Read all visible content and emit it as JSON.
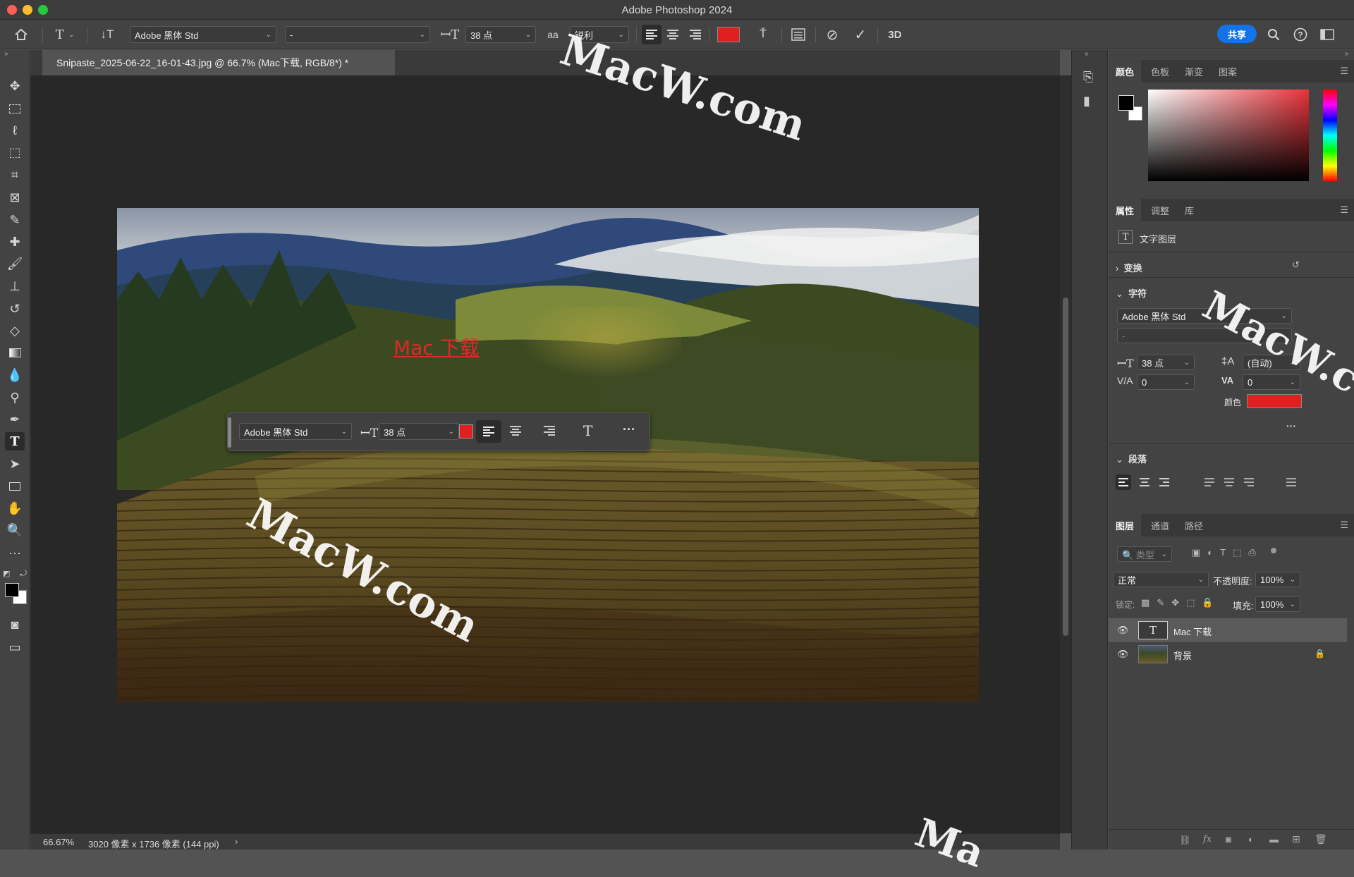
{
  "app": {
    "title": "Adobe Photoshop 2024",
    "share_label": "共享"
  },
  "options_bar": {
    "font_family": "Adobe 黑体 Std",
    "font_style": "-",
    "font_size": "38 点",
    "antialias_label": "aa",
    "antialias_value": "锐利",
    "text_color": "#e02020",
    "three_d_label": "3D"
  },
  "document": {
    "tab_title": "Snipaste_2025-06-22_16-01-43.jpg @ 66.7% (Mac下载, RGB/8*) *",
    "text_layer_content": "Mac 下载",
    "status_zoom": "66.67%",
    "status_info": "3020 像素 x 1736 像素 (144 ppi)"
  },
  "context_bar": {
    "font_family": "Adobe 黑体 Std",
    "font_size": "38 点",
    "color": "#e02020",
    "more_label": "···"
  },
  "color_panel": {
    "tabs": [
      "颜色",
      "色板",
      "渐变",
      "图案"
    ],
    "foreground": "#000000",
    "background": "#ffffff",
    "hue_color": "#e8333a"
  },
  "properties_panel": {
    "tabs": [
      "属性",
      "调整",
      "库"
    ],
    "layer_kind": "文字图层",
    "transform_label": "变换",
    "character_label": "字符",
    "font_family": "Adobe 黑体 Std",
    "font_style": "-",
    "size_value": "38 点",
    "leading_value": "(自动)",
    "kerning_value": "0",
    "tracking_value": "0",
    "color_label": "颜色",
    "color_value": "#e02020",
    "more_label": "···",
    "paragraph_label": "段落"
  },
  "layers_panel": {
    "tabs": [
      "图层",
      "通道",
      "路径"
    ],
    "filter_placeholder": "类型",
    "blend_mode": "正常",
    "opacity_label": "不透明度:",
    "opacity_value": "100%",
    "lock_label": "锁定:",
    "fill_label": "填充:",
    "fill_value": "100%",
    "layers": [
      {
        "name": "Mac 下载",
        "type": "text",
        "selected": true
      },
      {
        "name": "背景",
        "type": "image",
        "locked": true
      }
    ]
  },
  "watermarks": [
    "MacW.com",
    "MacW.com",
    "MacW.c",
    "Ma"
  ]
}
